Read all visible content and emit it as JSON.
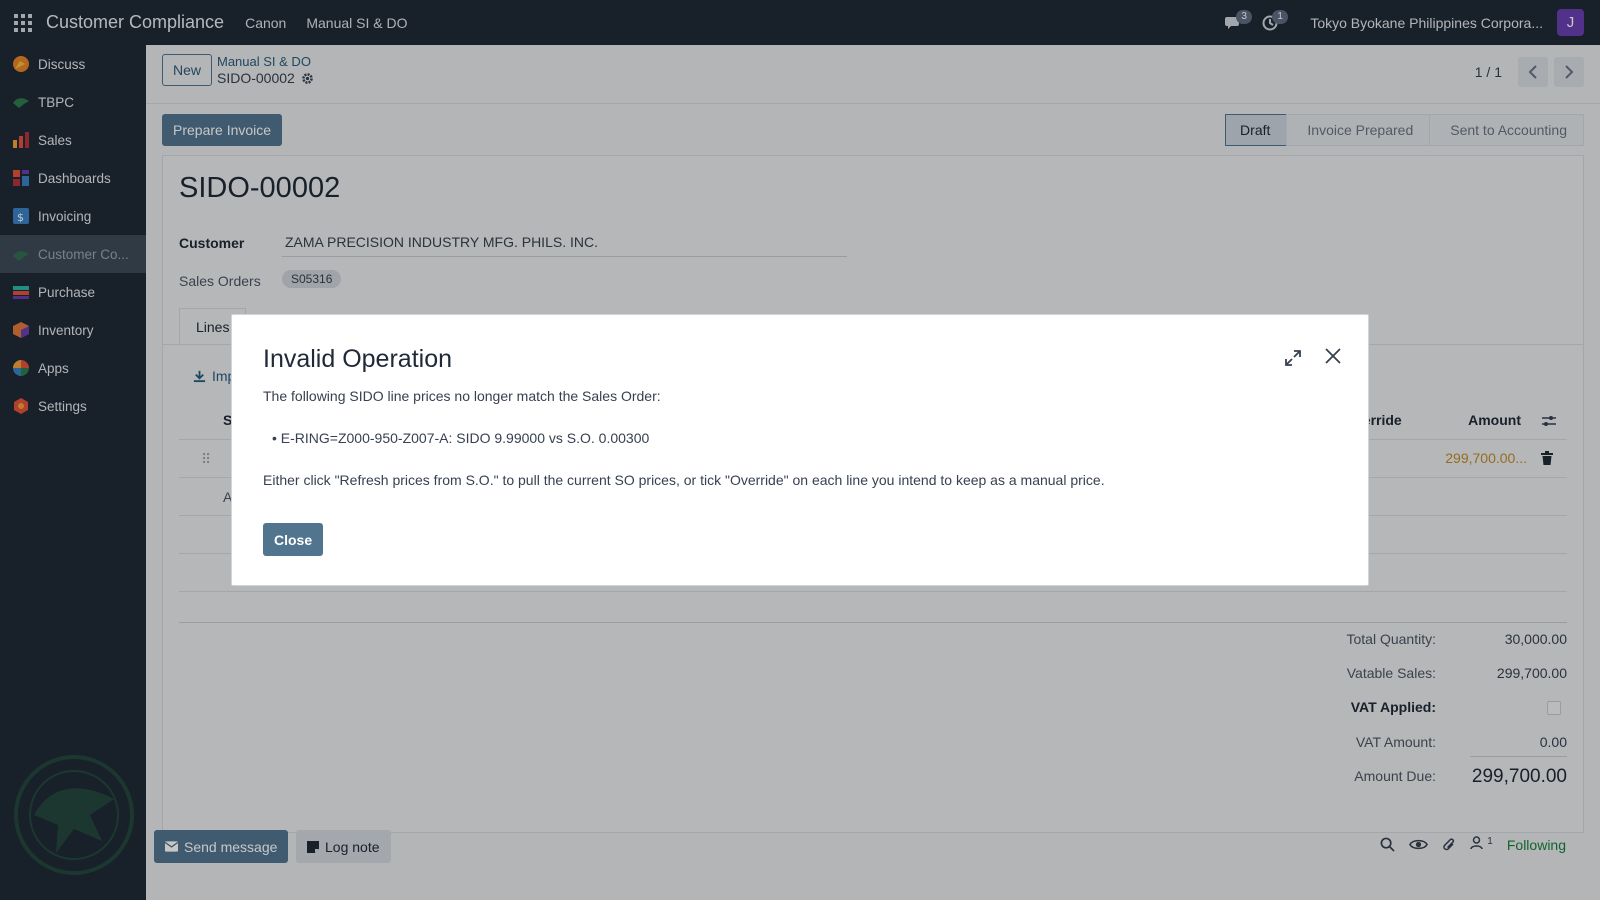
{
  "navbar": {
    "brand": "Customer Compliance",
    "menus": [
      "Canon",
      "Manual SI & DO"
    ],
    "messages_count": "3",
    "activities_count": "1",
    "company": "Tokyo Byokane Philippines Corpora...",
    "avatar_letter": "J"
  },
  "sidebar": {
    "items": [
      {
        "label": "Discuss",
        "icon": "discuss-icon"
      },
      {
        "label": "TBPC",
        "icon": "tbpc-icon"
      },
      {
        "label": "Sales",
        "icon": "sales-icon"
      },
      {
        "label": "Dashboards",
        "icon": "dashboards-icon"
      },
      {
        "label": "Invoicing",
        "icon": "invoicing-icon"
      },
      {
        "label": "Customer Co...",
        "icon": "customer-compliance-icon"
      },
      {
        "label": "Purchase",
        "icon": "purchase-icon"
      },
      {
        "label": "Inventory",
        "icon": "inventory-icon"
      },
      {
        "label": "Apps",
        "icon": "apps-icon"
      },
      {
        "label": "Settings",
        "icon": "settings-icon"
      }
    ],
    "active_index": 5
  },
  "control": {
    "new_label": "New",
    "breadcrumb_parent": "Manual SI & DO",
    "breadcrumb_current": "SIDO-00002",
    "pager": "1 / 1"
  },
  "status": {
    "action_label": "Prepare Invoice",
    "stages": [
      "Draft",
      "Invoice Prepared",
      "Sent to Accounting"
    ],
    "current_stage": "Draft"
  },
  "form": {
    "title": "SIDO-00002",
    "customer_label": "Customer",
    "customer_value": "ZAMA PRECISION INDUSTRY MFG. PHILS. INC.",
    "sales_orders_label": "Sales Orders",
    "sales_order_tag": "S05316",
    "tab_label": "Lines",
    "import_label": "Imp",
    "col_partial_left": "S",
    "col_override": "verride",
    "col_amount": "Amount",
    "row_partial": "A",
    "line_amount": "299,700.00..."
  },
  "totals": {
    "total_quantity_label": "Total Quantity:",
    "total_quantity_value": "30,000.00",
    "vatable_sales_label": "Vatable Sales:",
    "vatable_sales_value": "299,700.00",
    "vat_applied_label": "VAT Applied:",
    "vat_amount_label": "VAT Amount:",
    "vat_amount_value": "0.00",
    "amount_due_label": "Amount Due:",
    "amount_due_value": "299,700.00"
  },
  "chatter": {
    "send_message": "Send message",
    "log_note": "Log note",
    "followers_count": "1",
    "following": "Following"
  },
  "dialog": {
    "title": "Invalid Operation",
    "intro": "The following SIDO line prices no longer match the Sales Order:",
    "bullet": "E-RING=Z000-950-Z007-A: SIDO 9.99000 vs S.O. 0.00300",
    "instruction": "Either click \"Refresh prices from S.O.\" to pull the current SO prices, or tick \"Override\" on each line you intend to keep as a manual price.",
    "close_label": "Close"
  },
  "colors": {
    "navbar": "#1f2a36",
    "primary": "#52758f",
    "warning_amount": "#c08a2a",
    "following": "#17803d"
  }
}
